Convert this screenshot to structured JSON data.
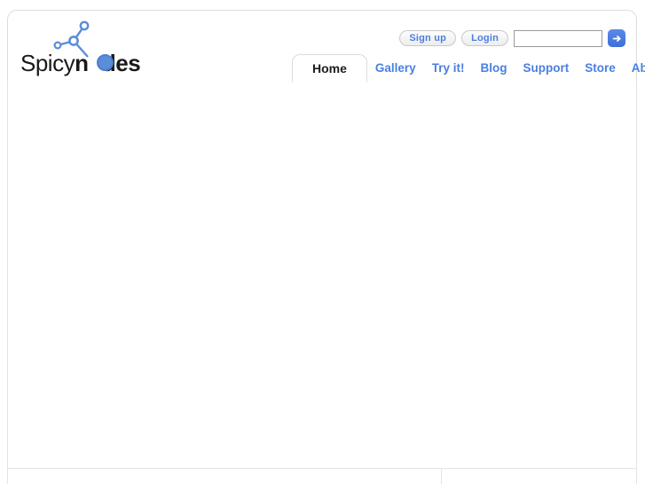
{
  "site": {
    "logo": {
      "text_before": "Spicy",
      "text_n": "n",
      "text_o": "o",
      "text_after": "des",
      "full_text": "Spicynodes",
      "mark_name": "node-graph-logo",
      "accent_color": "#5b8dd9"
    }
  },
  "topbar": {
    "signup_label": "Sign up",
    "login_label": "Login",
    "search": {
      "value": "",
      "placeholder": ""
    },
    "go_button_label": "→",
    "go_button_color": "#3d6fd8"
  },
  "nav": {
    "active_tab": "Home",
    "tabs": [
      {
        "label": "Home",
        "active": true
      },
      {
        "label": "Gallery",
        "active": false
      },
      {
        "label": "Try it!",
        "active": false
      },
      {
        "label": "Blog",
        "active": false
      },
      {
        "label": "Support",
        "active": false
      },
      {
        "label": "Store",
        "active": false
      },
      {
        "label": "About",
        "active": false
      }
    ],
    "link_color": "#4a7fe0",
    "active_color": "#1d1d1d"
  },
  "content": {
    "body_text": ""
  },
  "colors": {
    "page_background": "#ffffff",
    "border": "#dcdcdc",
    "divider": "#e4e4e4",
    "accent_blue": "#4a7fe0"
  }
}
